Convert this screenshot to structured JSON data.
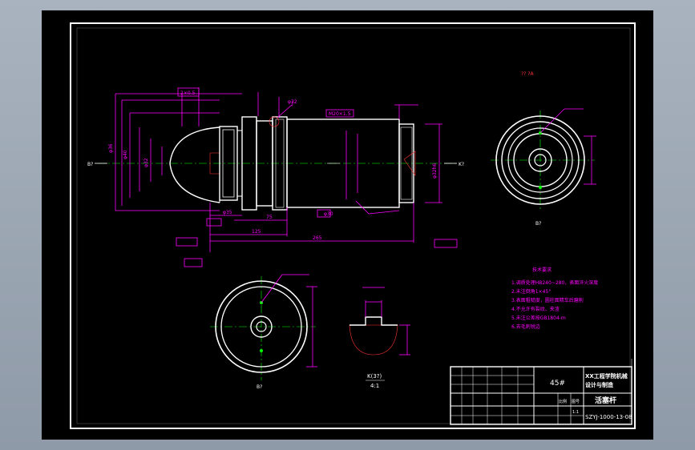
{
  "drawing": {
    "material": "45#",
    "part_name": "活塞杆",
    "school_line1": "XX工程学院机械",
    "school_line2": "设计与制造",
    "drawing_number": "SZYJ-1000-13-08",
    "scale": "1:1",
    "header_cells": [
      "比例",
      "图号"
    ],
    "view_labels": {
      "b_left": "B?",
      "k_right": "K?",
      "b_bottom_right": "B?",
      "b_bottom_left": "B?",
      "k_section": "K(3?)",
      "section_scale": "4:1",
      "top_right_note": "?? ?A"
    },
    "tech_req": {
      "title": "技术要求",
      "items": [
        "1.调质处理HB240~280，表面淬火深度",
        "2.未注倒角1×45°",
        "3.表面粗糙度，圆柱面精车后磨削",
        "4.不允许有裂纹、夹渣",
        "5.未注公差按GB1804-m",
        "6.去毛刺锐边"
      ]
    },
    "dims": {
      "top": [
        "2×0.5",
        "φ32",
        "M20×1.5"
      ],
      "bottom": [
        "φ35",
        "φ30",
        "75",
        "125",
        "265"
      ],
      "left": [
        "φ36",
        "φ40",
        "φ32"
      ],
      "right": [
        "φ32h6"
      ]
    }
  }
}
